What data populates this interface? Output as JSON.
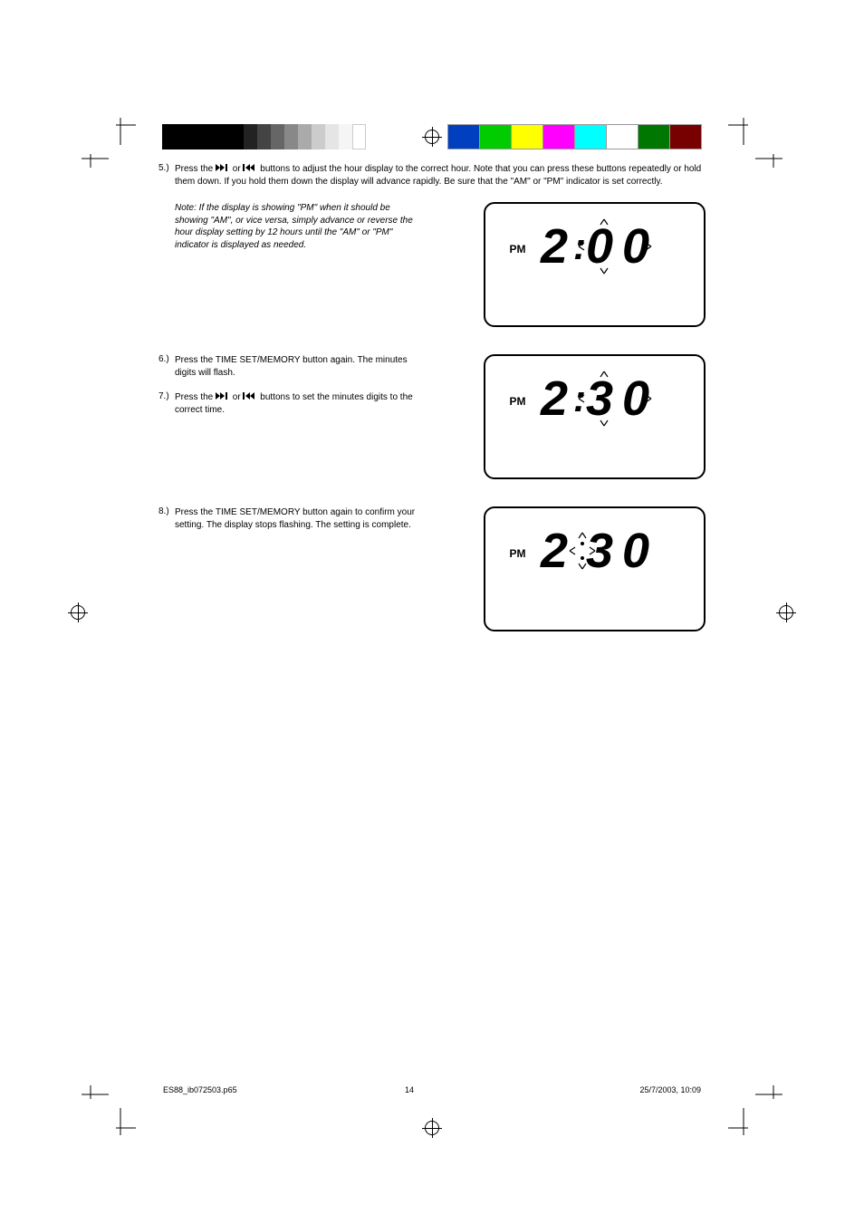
{
  "steps": {
    "s5": {
      "num": "5.)",
      "text_parts": [
        "Press the ",
        " or ",
        " buttons to adjust the hour display to the correct hour. Note that you can press these buttons repeatedly or hold them down. If you hold them down the display will advance rapidly. Be sure that the \"AM\" or \"PM\" indicator is set correctly."
      ],
      "note": "Note: If the display is showing \"PM\" when it should be showing \"AM\", or vice versa, simply advance or reverse the hour display setting by 12 hours until the \"AM\" or \"PM\" indicator is displayed as needed."
    },
    "s6": {
      "num": "6.)",
      "text": "Press the TIME SET/MEMORY button again. The minutes digits will flash."
    },
    "s7": {
      "num": "7.)",
      "text_parts": [
        "Press the ",
        " or ",
        " buttons to set the minutes digits to the correct time."
      ]
    },
    "s8": {
      "num": "8.)",
      "text": "Press the TIME SET/MEMORY button again to confirm your setting. The display stops flashing. The setting is complete."
    }
  },
  "displays": {
    "pm": "PM",
    "d1": {
      "h": "2",
      "m": "00"
    },
    "d2": {
      "h": "2",
      "m": "30"
    },
    "d3": {
      "h": "2",
      "m": "30"
    }
  },
  "footer": {
    "file": "ES88_ib072503.p65",
    "page": "14",
    "date": "25/7/2003, 10:09"
  },
  "icons": {
    "fwd": "skip-forward-icon",
    "back": "skip-backward-icon"
  }
}
